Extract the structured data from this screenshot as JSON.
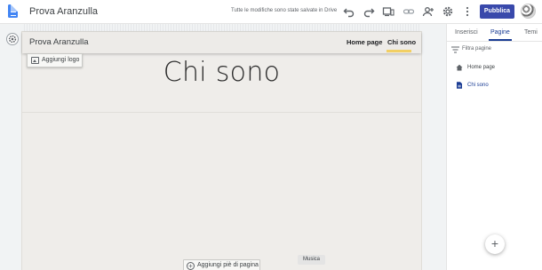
{
  "topbar": {
    "site_title": "Prova Aranzulla",
    "save_status": "Tutte le modifiche sono state salvate in Drive",
    "publish_label": "Pubblica",
    "icons": [
      "undo-icon",
      "redo-icon",
      "preview-icon",
      "link-icon",
      "share-icon",
      "settings-icon",
      "more-icon"
    ]
  },
  "site": {
    "title": "Prova Aranzulla",
    "nav": [
      {
        "label": "Home page",
        "active": false
      },
      {
        "label": "Chi sono",
        "active": true
      }
    ],
    "add_logo_label": "Aggiungi logo",
    "hero_title": "Chi sono",
    "add_footer_label": "Aggiungi piè di pagina",
    "tooltip": "Musica"
  },
  "panel": {
    "tabs": [
      {
        "label": "Inserisci",
        "active": false
      },
      {
        "label": "Pagine",
        "active": true
      },
      {
        "label": "Temi",
        "active": false
      }
    ],
    "filter_placeholder": "Filtra pagine",
    "pages": [
      {
        "label": "Home page",
        "icon": "home-icon",
        "active": false
      },
      {
        "label": "Chi sono",
        "icon": "document-icon",
        "active": true
      }
    ],
    "fab_label": "+"
  },
  "colors": {
    "accent": "#1a3c94",
    "publish": "#3949ab",
    "nav_active": "#f2cf63"
  }
}
